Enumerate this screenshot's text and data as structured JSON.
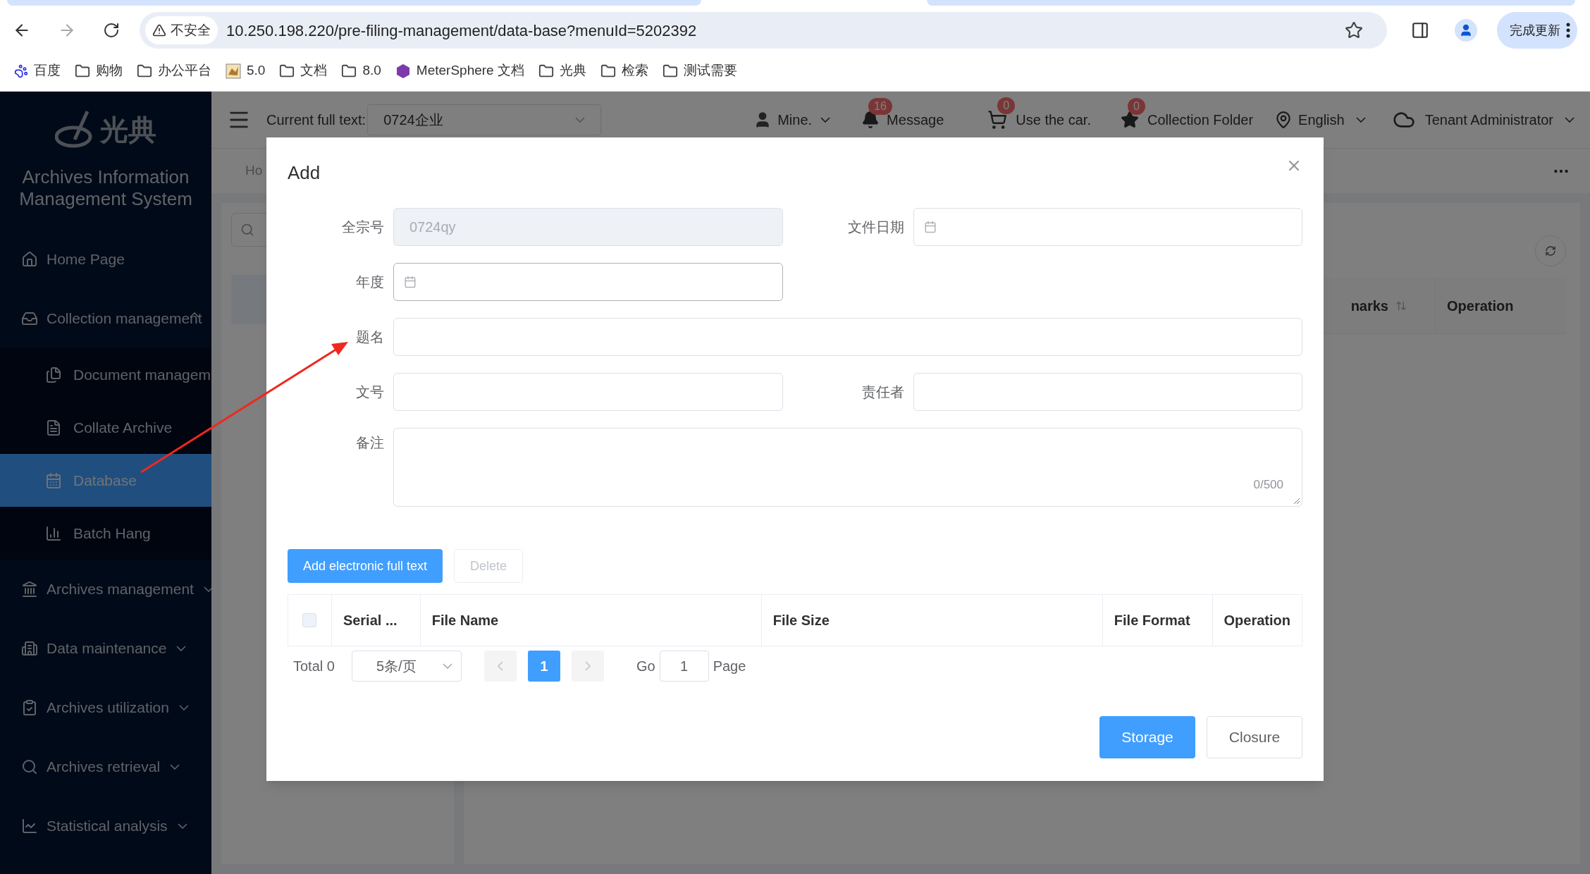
{
  "browser": {
    "security": "不安全",
    "url": "10.250.198.220/pre-filing-management/data-base?menuId=5202392",
    "update_button": "完成更新",
    "bookmarks": [
      {
        "kind": "baidu",
        "label": "百度"
      },
      {
        "kind": "folder",
        "label": "购物"
      },
      {
        "kind": "folder",
        "label": "办公平台"
      },
      {
        "kind": "cat",
        "label": "5.0"
      },
      {
        "kind": "folder",
        "label": "文档"
      },
      {
        "kind": "folder",
        "label": "8.0"
      },
      {
        "kind": "ms",
        "label": "MeterSphere 文档"
      },
      {
        "kind": "folder",
        "label": "光典"
      },
      {
        "kind": "folder",
        "label": "检索"
      },
      {
        "kind": "folder",
        "label": "测试需要"
      }
    ]
  },
  "sidebar": {
    "logo_text": "光典",
    "system_title": "Archives Information Management System",
    "items": [
      {
        "label": "Home Page",
        "selected": false
      },
      {
        "label": "Collection management",
        "selected": false,
        "expanded": true,
        "children": [
          {
            "label": "Document managem",
            "selected": false
          },
          {
            "label": "Collate Archive",
            "selected": false
          },
          {
            "label": "Database",
            "selected": true
          },
          {
            "label": "Batch Hang",
            "selected": false
          }
        ]
      },
      {
        "label": "Archives management",
        "selected": false,
        "expanded": false
      },
      {
        "label": "Data maintenance",
        "selected": false,
        "expanded": false
      },
      {
        "label": "Archives utilization",
        "selected": false,
        "expanded": false
      },
      {
        "label": "Archives retrieval",
        "selected": false,
        "expanded": false
      },
      {
        "label": "Statistical analysis",
        "selected": false,
        "expanded": false
      }
    ]
  },
  "header": {
    "full_text_label": "Current full text:",
    "full_text_value": "0724企业",
    "user": "Mine.",
    "message_count": "16",
    "message": "Message",
    "cart_count": "0",
    "cart": "Use the car.",
    "collection_count": "0",
    "collection": "Collection Folder",
    "language": "English",
    "tenant": "Tenant Administrator"
  },
  "background": {
    "breadcrumb": "Ho",
    "columns": [
      "narks",
      "Operation"
    ]
  },
  "dialog": {
    "title": "Add",
    "fields": [
      {
        "label": "全宗号",
        "kind": "text",
        "value": "0724qy",
        "disabled": true,
        "focused": false,
        "full_width": false
      },
      {
        "label": "文件日期",
        "kind": "date",
        "disabled": false,
        "focused": false,
        "full_width": false
      },
      {
        "label": "年度",
        "kind": "date",
        "disabled": false,
        "focused": true,
        "full_width": false
      },
      {
        "label": "题名",
        "kind": "text",
        "disabled": false,
        "focused": false,
        "full_width": true
      },
      {
        "label": "文号",
        "kind": "text",
        "disabled": false,
        "focused": false,
        "full_width": false
      },
      {
        "label": "责任者",
        "kind": "text",
        "disabled": false,
        "focused": false,
        "full_width": false
      },
      {
        "label": "备注",
        "kind": "textarea",
        "counter": "0/500",
        "disabled": false,
        "focused": false,
        "full_width": true
      }
    ],
    "actions": [
      {
        "label": "Add electronic full text",
        "disabled": false,
        "kind": "primary"
      },
      {
        "label": "Delete",
        "disabled": true,
        "kind": "plain"
      }
    ],
    "table": {
      "select_all_checked": false,
      "columns": [
        "Serial ...",
        "File Name",
        "File Size",
        "File Format",
        "Operation"
      ]
    },
    "pagination": {
      "total": "Total 0",
      "page_size": "5条/页",
      "pages": [
        {
          "label": "1",
          "selected": true
        }
      ],
      "go": "Go",
      "page_input": "1",
      "page_word": "Page"
    },
    "footer": [
      {
        "label": "Storage",
        "kind": "primary"
      },
      {
        "label": "Closure",
        "kind": "plain"
      }
    ]
  }
}
